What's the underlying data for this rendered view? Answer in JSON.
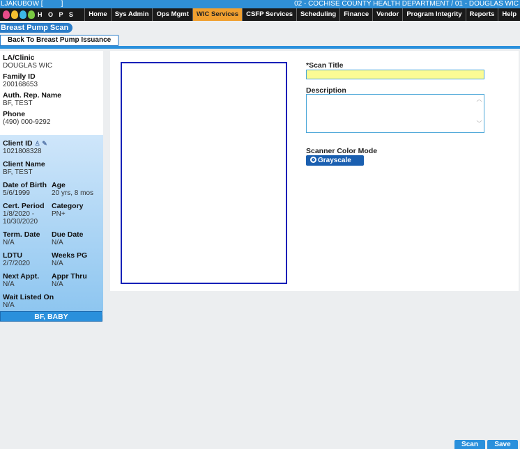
{
  "topbar": {
    "user": "LJAKUBOW [",
    "user_end": "]",
    "department": "02 - COCHISE COUNTY HEALTH DEPARTMENT / 01 - DOUGLAS WIC"
  },
  "logo": {
    "text": "H O P S"
  },
  "menu": [
    {
      "label": "Home"
    },
    {
      "label": "Sys Admin"
    },
    {
      "label": "Ops Mgmt"
    },
    {
      "label": "WIC Services",
      "active": true
    },
    {
      "label": "CSFP Services"
    },
    {
      "label": "Scheduling"
    },
    {
      "label": "Finance"
    },
    {
      "label": "Vendor"
    },
    {
      "label": "Program Integrity"
    },
    {
      "label": "Reports"
    },
    {
      "label": "Help"
    }
  ],
  "page": {
    "title": "Breast Pump Scan",
    "back_button": "Back To Breast Pump Issuance"
  },
  "family": {
    "clinic_label": "LA/Clinic",
    "clinic": "DOUGLAS WIC",
    "family_id_label": "Family ID",
    "family_id": "200168653",
    "auth_rep_label": "Auth. Rep. Name",
    "auth_rep": "BF, TEST",
    "phone_label": "Phone",
    "phone": "(490) 000-9292"
  },
  "client": {
    "client_id_label": "Client ID",
    "client_id": "1021808328",
    "client_name_label": "Client Name",
    "client_name": "BF, TEST",
    "dob_label": "Date of Birth",
    "dob": "5/6/1999",
    "age_label": "Age",
    "age": "20 yrs, 8 mos",
    "cert_label": "Cert. Period",
    "cert_line1": "1/8/2020 -",
    "cert_line2": "10/30/2020",
    "category_label": "Category",
    "category": "PN+",
    "term_label": "Term. Date",
    "term": "N/A",
    "due_label": "Due Date",
    "due": "N/A",
    "ldtu_label": "LDTU",
    "ldtu": "2/7/2020",
    "weeks_label": "Weeks PG",
    "weeks": "N/A",
    "next_appt_label": "Next Appt.",
    "next_appt": "N/A",
    "appr_label": "Appr Thru",
    "appr": "N/A",
    "wait_label": "Wait Listed On",
    "wait": "N/A",
    "baby_label": "BF, BABY"
  },
  "form": {
    "scan_title_label": "*Scan Title",
    "scan_title_value": "",
    "description_label": "Description",
    "description_value": "",
    "color_mode_label": "Scanner Color Mode",
    "color_mode_value": "Grayscale"
  },
  "buttons": {
    "scan": "Scan",
    "save": "Save"
  }
}
